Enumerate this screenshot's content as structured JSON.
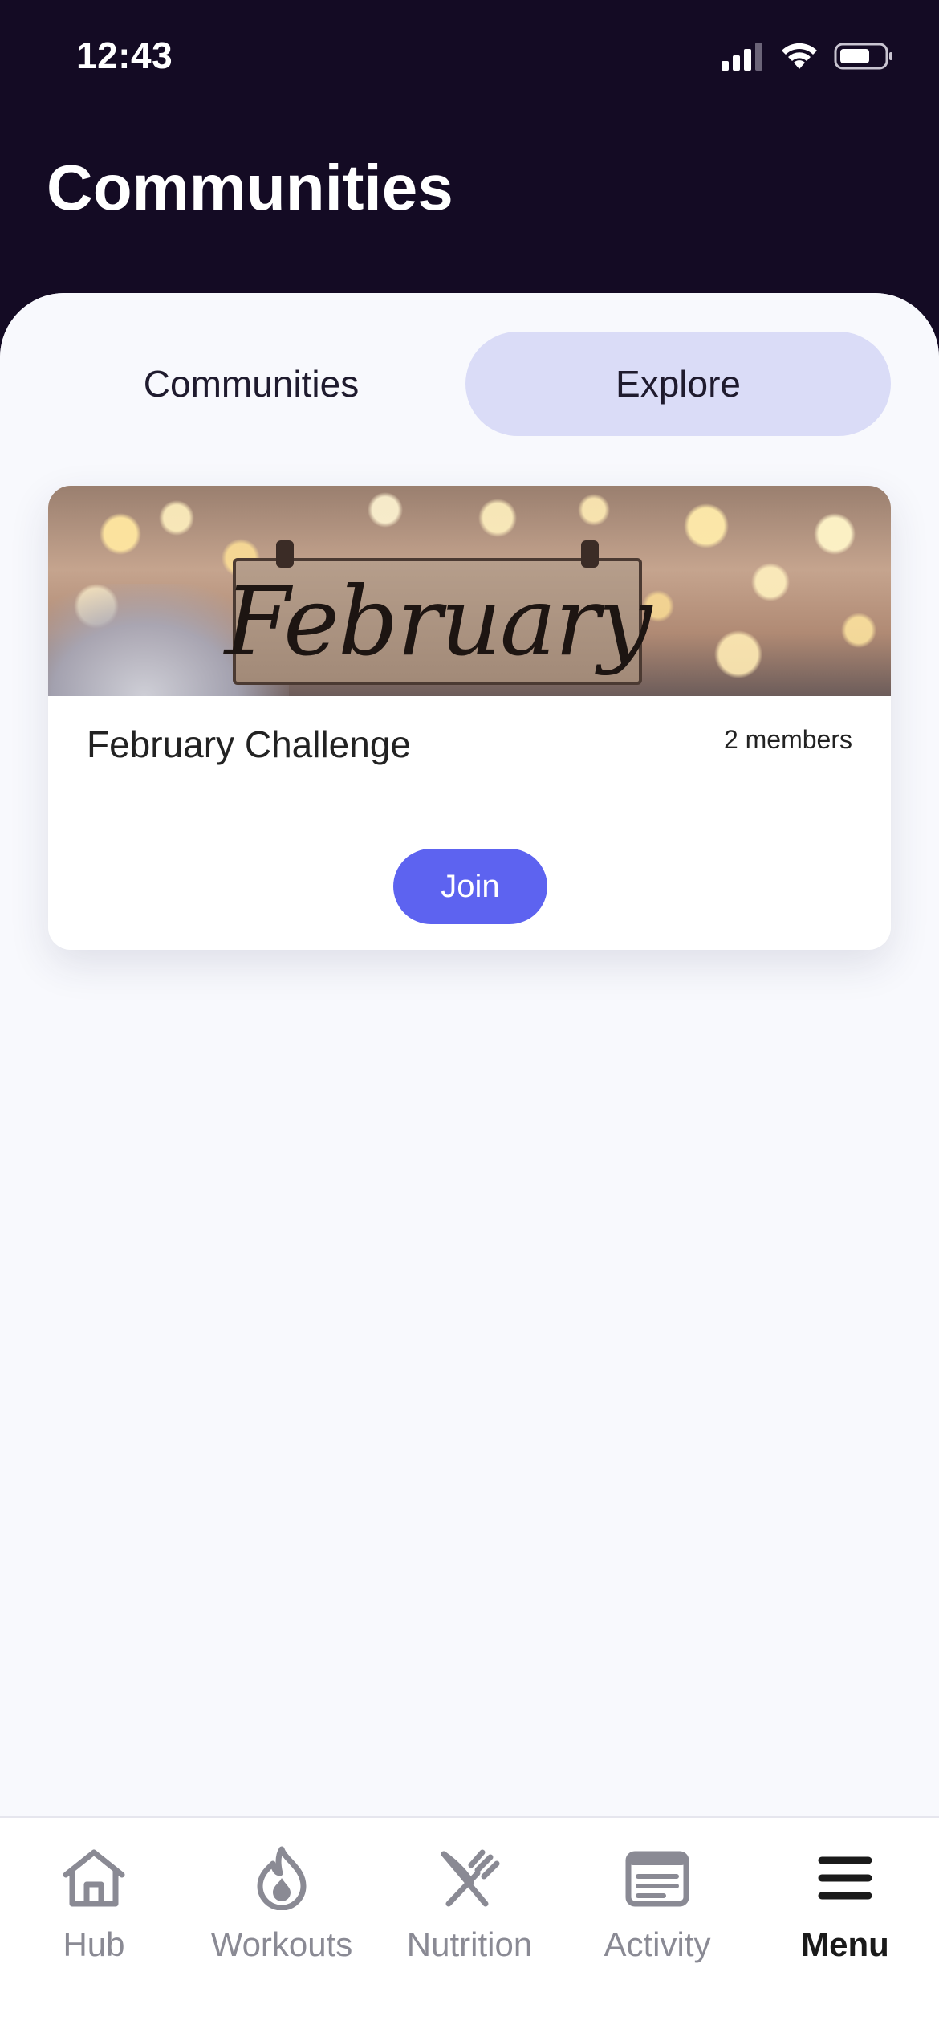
{
  "status_bar": {
    "time": "12:43"
  },
  "header": {
    "title": "Communities"
  },
  "tabs": [
    {
      "label": "Communities",
      "selected": false
    },
    {
      "label": "Explore",
      "selected": true
    }
  ],
  "community_card": {
    "image_text": "February",
    "title": "February Challenge",
    "members": "2 members",
    "join_label": "Join"
  },
  "bottom_nav": {
    "items": [
      {
        "label": "Hub",
        "icon": "home-icon",
        "active": false
      },
      {
        "label": "Workouts",
        "icon": "flame-icon",
        "active": false
      },
      {
        "label": "Nutrition",
        "icon": "fork-knife-icon",
        "active": false
      },
      {
        "label": "Activity",
        "icon": "activity-feed-icon",
        "active": false
      },
      {
        "label": "Menu",
        "icon": "hamburger-menu-icon",
        "active": true
      }
    ]
  },
  "colors": {
    "header_bg": "#140b24",
    "sheet_bg": "#f8f9fd",
    "selected_tab_bg": "#dadcf7",
    "join_button": "#5d63f0"
  }
}
